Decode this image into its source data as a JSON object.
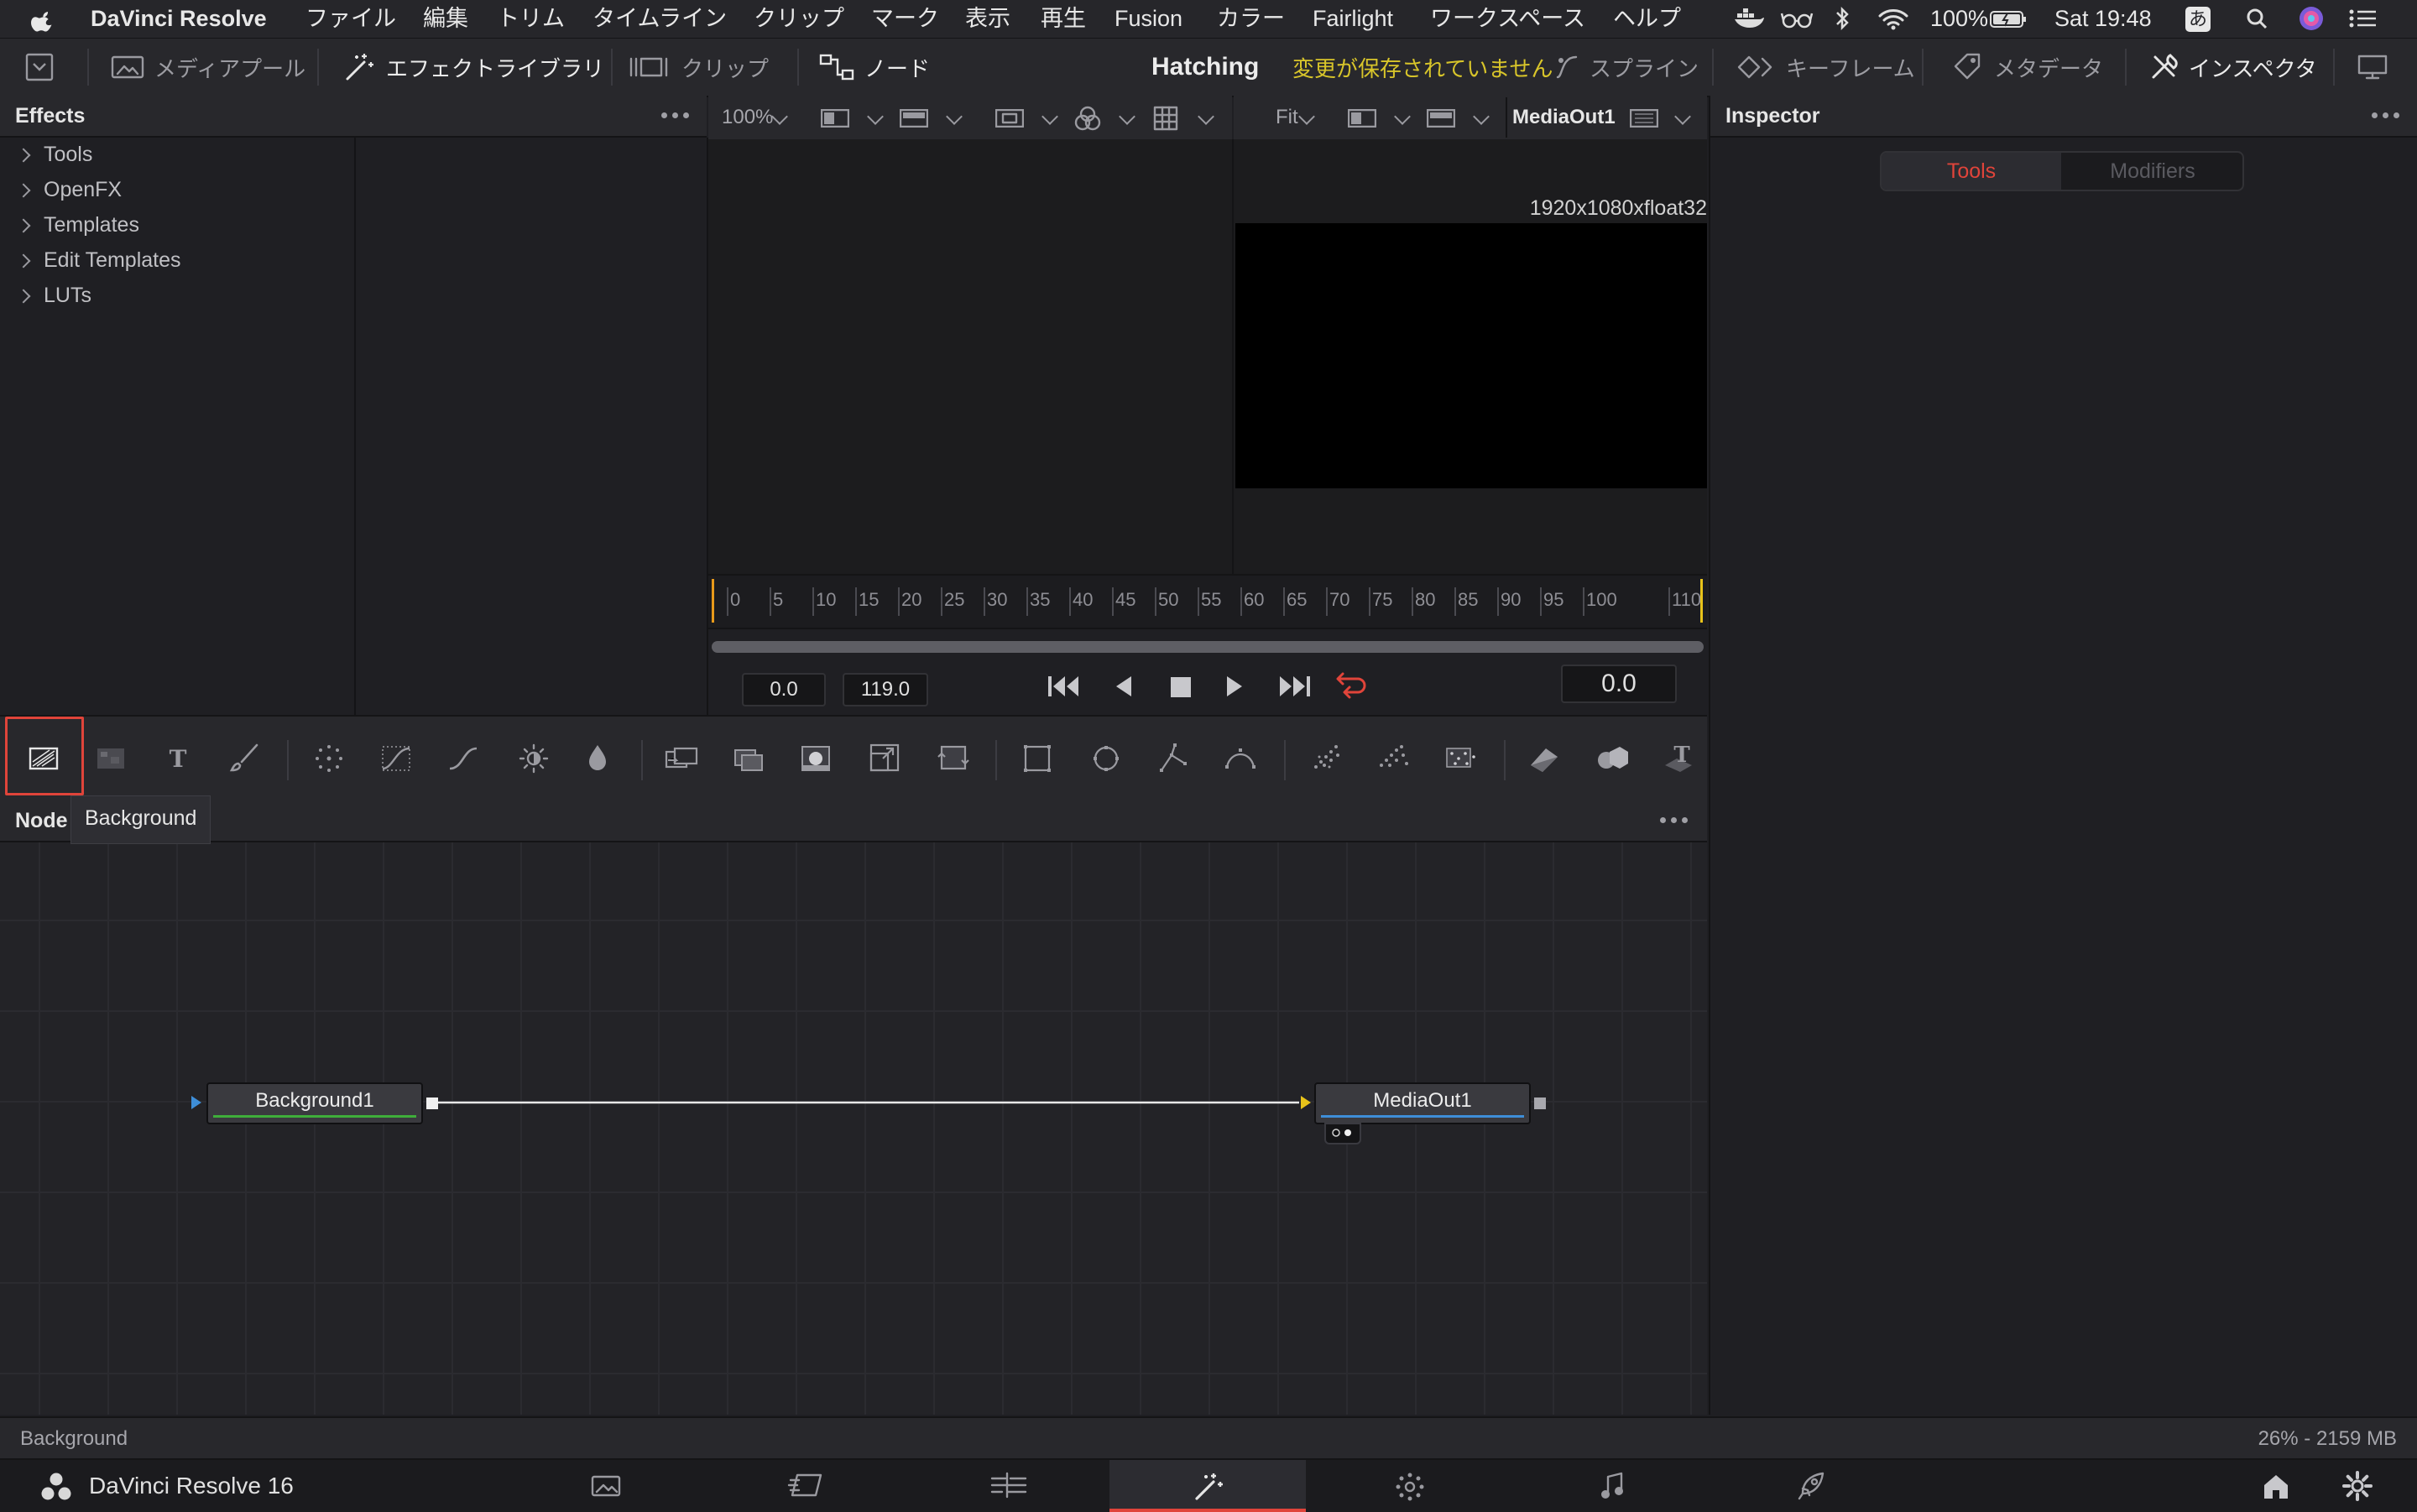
{
  "menubar": {
    "app": "DaVinci Resolve",
    "items": [
      "ファイル",
      "編集",
      "トリム",
      "タイムライン",
      "クリップ",
      "マーク",
      "表示",
      "再生",
      "Fusion",
      "カラー",
      "Fairlight",
      "ワークスペース",
      "ヘルプ"
    ],
    "battery": "100%",
    "clock": "Sat 19:48",
    "input_mode": "あ"
  },
  "toolbar": {
    "media_pool": "メディアプール",
    "effects_library": "エフェクトライブラリ",
    "clip": "クリップ",
    "nodes": "ノード",
    "project_title": "Hatching",
    "unsaved": "変更が保存されていません",
    "spline": "スプライン",
    "keyframes": "キーフレーム",
    "metadata": "メタデータ",
    "inspector": "インスペクタ"
  },
  "effects": {
    "title": "Effects",
    "tree": [
      "Tools",
      "OpenFX",
      "Templates",
      "Edit Templates",
      "LUTs"
    ]
  },
  "viewer_left": {
    "zoom": "100%"
  },
  "viewer_right": {
    "zoom": "Fit",
    "node": "MediaOut1",
    "resolution": "1920x1080xfloat32"
  },
  "ruler": {
    "labels": [
      "0",
      "5",
      "10",
      "15",
      "20",
      "25",
      "30",
      "35",
      "40",
      "45",
      "50",
      "55",
      "60",
      "65",
      "70",
      "75",
      "80",
      "85",
      "90",
      "95",
      "100",
      "110"
    ]
  },
  "transport": {
    "start": "0.0",
    "end": "119.0",
    "current": "0.0"
  },
  "tools_row": {
    "tooltip": "Background",
    "icons": [
      "background-icon",
      "fast-noise-icon",
      "text-icon",
      "paint-icon",
      "particles-icon",
      "color-curves-icon",
      "curve-icon",
      "brightness-icon",
      "blur-icon",
      "merge-icon",
      "channel-booleans-icon",
      "matte-control-icon",
      "resize-icon",
      "transform-icon",
      "rectangle-mask-icon",
      "ellipse-mask-icon",
      "polygon-mask-icon",
      "bspline-mask-icon",
      "p-emitter-icon",
      "p-render-icon",
      "p-merge-icon",
      "shape3d-icon",
      "merge3d-icon",
      "text3d-icon"
    ]
  },
  "node_editor": {
    "title": "Node",
    "nodes": [
      {
        "name": "Background1",
        "accent": "#3fae3a"
      },
      {
        "name": "MediaOut1",
        "accent": "#3e8ed8"
      }
    ]
  },
  "inspector": {
    "title": "Inspector",
    "tabs": [
      "Tools",
      "Modifiers"
    ],
    "active_tab": "Tools"
  },
  "status": {
    "left": "Background",
    "right": "26% - 2159 MB"
  },
  "pagebar": {
    "app_name": "DaVinci Resolve 16",
    "pages": [
      "media-page-icon",
      "cut-page-icon",
      "edit-page-icon",
      "fusion-page-icon",
      "color-page-icon",
      "fairlight-page-icon",
      "deliver-page-icon"
    ],
    "active": "fusion-page-icon"
  },
  "colors": {
    "accent_red": "#e0443a",
    "unsaved_yellow": "#d8c52a",
    "bg": "#1f1f23"
  }
}
